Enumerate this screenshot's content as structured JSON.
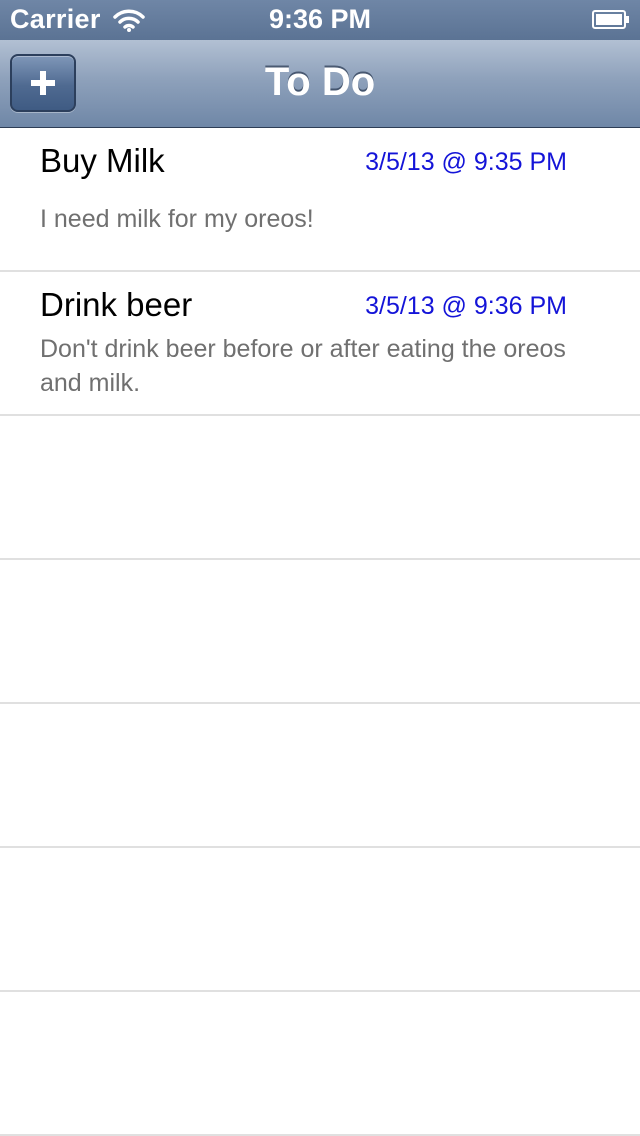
{
  "status_bar": {
    "carrier": "Carrier",
    "time": "9:36 PM",
    "wifi_icon": "wifi-icon",
    "battery_icon": "battery-icon"
  },
  "nav_bar": {
    "title": "To Do",
    "add_button_icon": "plus-icon",
    "colors": {
      "bar_top": "#b2c0d3",
      "bar_bottom": "#6f87a7",
      "button": "#4f6a91"
    }
  },
  "todos": [
    {
      "title": "Buy Milk",
      "date": "3/5/13 @ 9:35 PM",
      "note": "I need milk for my oreos!"
    },
    {
      "title": "Drink beer",
      "date": "3/5/13 @ 9:36 PM",
      "note": "Don't drink beer before or after eating the oreos and milk."
    }
  ],
  "colors": {
    "date_text": "#1414d8",
    "note_text": "#707070",
    "separator": "#e0e0e0"
  }
}
